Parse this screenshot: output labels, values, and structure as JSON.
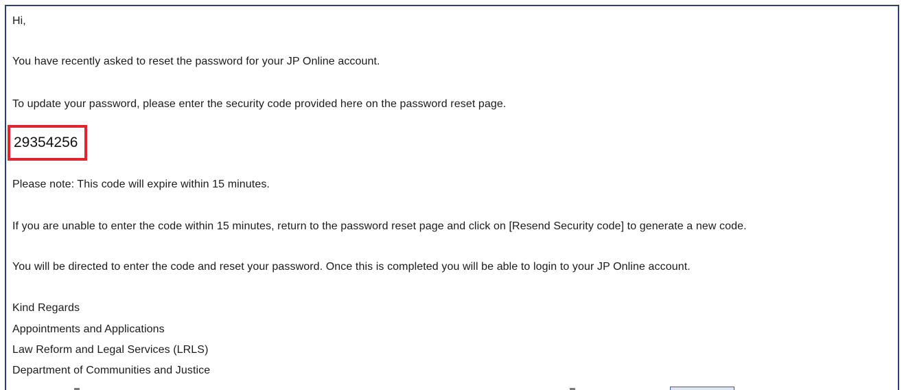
{
  "email": {
    "greeting": "Hi,",
    "paragraph_request": "You have recently asked to reset the password for your JP Online account.",
    "paragraph_instruction": "To update your password, please enter the security code provided here on the password reset page.",
    "security_code": "29354256",
    "paragraph_expiry": "Please note: This code will expire within 15 minutes.",
    "paragraph_resend": "If you are unable to enter the code within 15 minutes, return to the password reset page and click on [Resend Security code] to generate a new code.",
    "paragraph_directed": "You will be directed to enter the code and reset your password. Once this is completed you will be able to login to your JP Online account.",
    "signature": {
      "closing": "Kind Regards",
      "line1": "Appointments and Applications",
      "line2": "Law Reform and Legal Services (LRLS)",
      "line3": "Department of Communities and Justice"
    }
  },
  "colors": {
    "frame_border": "#2b3f73",
    "highlight_box": "#e0252e",
    "text": "#1a1a1a"
  }
}
